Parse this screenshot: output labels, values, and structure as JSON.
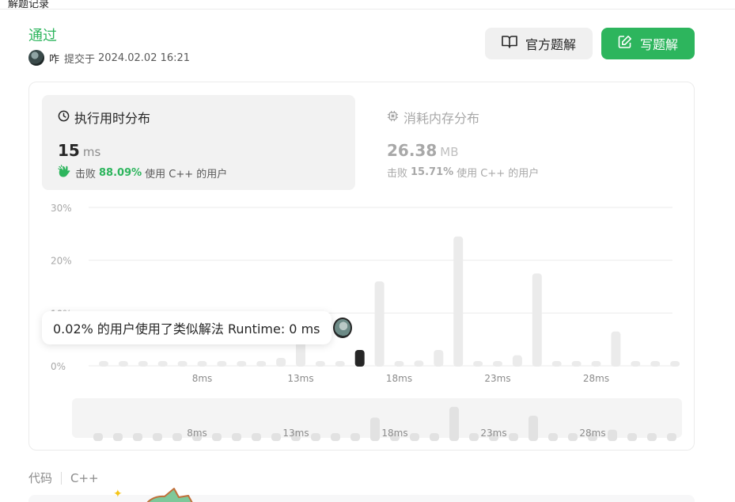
{
  "topbar": {
    "cut_text": "解题记录"
  },
  "submission": {
    "status": "通过",
    "user": "咋",
    "submitted_label": "提交于",
    "submitted_at": "2024.02.02 16:21"
  },
  "buttons": {
    "official_solution": "官方题解",
    "write_solution": "写题解"
  },
  "runtime": {
    "title": "执行用时分布",
    "value": "15",
    "unit": "ms",
    "beats_label": "击败",
    "beats_pct": "88.09%",
    "beats_suffix": "使用 C++ 的用户"
  },
  "memory": {
    "title": "消耗内存分布",
    "value": "26.38",
    "unit": "MB",
    "beats_label": "击败",
    "beats_pct": "15.71%",
    "beats_suffix": "使用 C++ 的用户"
  },
  "tooltip": {
    "text": "0.02% 的用户使用了类似解法 Runtime: 0 ms"
  },
  "colors": {
    "accent": "#2db55d",
    "bar": "#ebebeb",
    "bar_selected": "#262626"
  },
  "chart_data": {
    "type": "bar",
    "y_ticks": [
      "30%",
      "20%",
      "10%",
      "0%"
    ],
    "ylim": [
      0,
      30
    ],
    "x_tick_labels": [
      "8ms",
      "13ms",
      "18ms",
      "23ms",
      "28ms"
    ],
    "x_tick_indices": [
      5,
      10,
      15,
      20,
      25
    ],
    "grid": true,
    "values": [
      0.5,
      0.5,
      0.5,
      0.5,
      0.5,
      0.5,
      0.5,
      0.5,
      0.5,
      1.5,
      5,
      0.5,
      0.5,
      3,
      16,
      0.5,
      1,
      3,
      24.5,
      0.5,
      0.5,
      2,
      17.5,
      0.5,
      0.5,
      0.5,
      6.5,
      0.5,
      0.5,
      0.5
    ],
    "highlight_index": 13,
    "navigator_labels": [
      "8ms",
      "13ms",
      "18ms",
      "23ms",
      "28ms"
    ]
  },
  "code": {
    "label": "代码",
    "language": "C++"
  }
}
